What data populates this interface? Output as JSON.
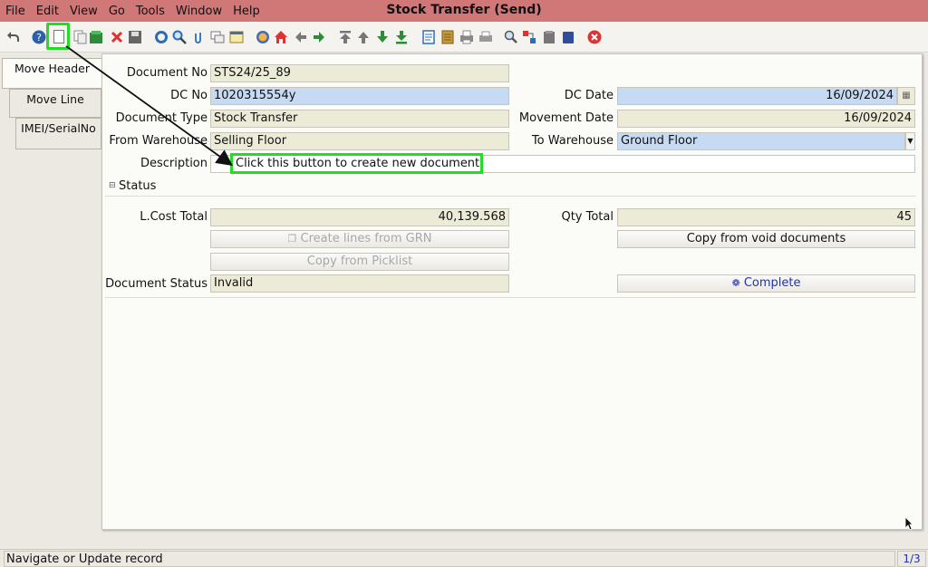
{
  "menu": {
    "items": [
      "File",
      "Edit",
      "View",
      "Go",
      "Tools",
      "Window",
      "Help"
    ],
    "title": "Stock Transfer (Send)"
  },
  "toolbar": {
    "icons": [
      "undo-icon",
      "help-icon",
      "new-document-icon",
      "copy-icon",
      "archive-icon",
      "delete-icon",
      "save-icon",
      "refresh-icon",
      "find-icon",
      "attachment-icon",
      "chat-icon",
      "history-icon",
      "home-icon",
      "back-icon",
      "forward-icon",
      "first-record-icon",
      "previous-record-icon",
      "next-record-icon",
      "last-record-icon",
      "report-icon",
      "archived-docs-icon",
      "print-icon",
      "print-preview-icon",
      "zoom-icon",
      "workflow-icon",
      "product-info-icon",
      "end-icon",
      "close-icon"
    ]
  },
  "tabs": [
    "Move Header",
    "Move Line",
    "IMEI/SerialNo"
  ],
  "form": {
    "document_no": {
      "label": "Document No",
      "value": "STS24/25_89"
    },
    "dc_no": {
      "label": "DC No",
      "value": "1020315554y"
    },
    "dc_date": {
      "label": "DC Date",
      "value": "16/09/2024"
    },
    "document_type": {
      "label": "Document Type",
      "value": "Stock Transfer"
    },
    "movement_date": {
      "label": "Movement Date",
      "value": "16/09/2024"
    },
    "from_warehouse": {
      "label": "From Warehouse",
      "value": "Selling Floor"
    },
    "to_warehouse": {
      "label": "To Warehouse",
      "value": "Ground Floor"
    },
    "description": {
      "label": "Description",
      "value": ""
    }
  },
  "callout": {
    "text": "Click this button  to create new document"
  },
  "status": {
    "section_label": "Status",
    "lcost_total": {
      "label": "L.Cost Total",
      "value": "40,139.568"
    },
    "qty_total": {
      "label": "Qty Total",
      "value": "45"
    },
    "create_lines_label": "Create lines from GRN",
    "copy_void_label": "Copy from void documents",
    "copy_picklist_label": "Copy from Picklist",
    "document_status": {
      "label": "Document Status",
      "value": "Invalid"
    },
    "complete_label": "Complete"
  },
  "statusbar": {
    "text": "Navigate or Update record",
    "page": "1/3"
  },
  "colors": {
    "accent": "#2232a8",
    "highlight": "#22dd22",
    "title_bar": "#d07878"
  }
}
